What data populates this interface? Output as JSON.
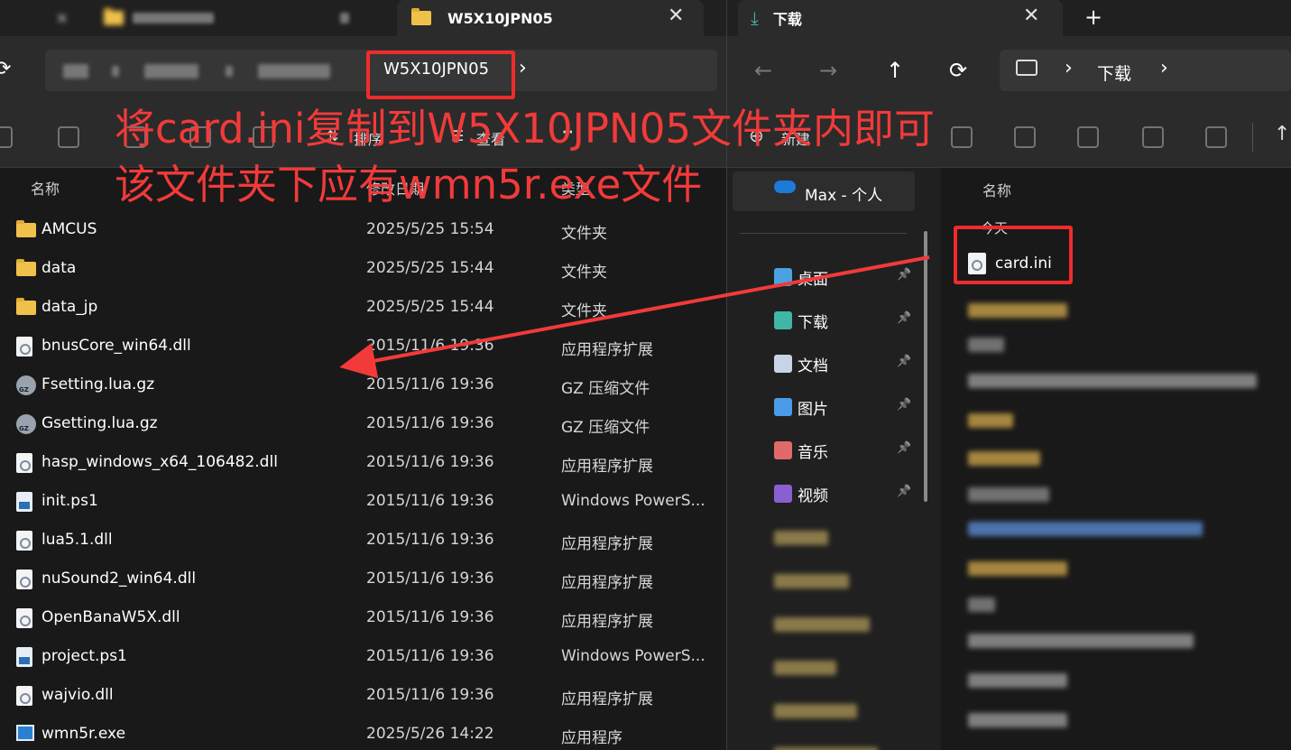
{
  "left_window": {
    "tabs": {
      "inactive_label": "",
      "active_title": "W5X10JPN05",
      "close": "✕"
    },
    "address": {
      "current_folder": "W5X10JPN05",
      "chevron": "›",
      "refresh": "⟳"
    },
    "toolbar": {
      "sort_label": "排序",
      "view_label": "查看",
      "more_label": "⋯"
    },
    "columns": {
      "name": "名称",
      "date": "修改日期",
      "type": "类型"
    },
    "files": [
      {
        "name": "AMCUS",
        "date": "2025/5/25 15:54",
        "type": "文件夹",
        "icon": "folder-icon"
      },
      {
        "name": "data",
        "date": "2025/5/25 15:44",
        "type": "文件夹",
        "icon": "folder-icon"
      },
      {
        "name": "data_jp",
        "date": "2025/5/25 15:44",
        "type": "文件夹",
        "icon": "folder-icon"
      },
      {
        "name": "bnusCore_win64.dll",
        "date": "2015/11/6 19:36",
        "type": "应用程序扩展",
        "icon": "dll-file-icon"
      },
      {
        "name": "Fsetting.lua.gz",
        "date": "2015/11/6 19:36",
        "type": "GZ 压缩文件",
        "icon": "gz-file-icon"
      },
      {
        "name": "Gsetting.lua.gz",
        "date": "2015/11/6 19:36",
        "type": "GZ 压缩文件",
        "icon": "gz-file-icon"
      },
      {
        "name": "hasp_windows_x64_106482.dll",
        "date": "2015/11/6 19:36",
        "type": "应用程序扩展",
        "icon": "dll-file-icon"
      },
      {
        "name": "init.ps1",
        "date": "2015/11/6 19:36",
        "type": "Windows PowerS...",
        "icon": "powershell-file-icon"
      },
      {
        "name": "lua5.1.dll",
        "date": "2015/11/6 19:36",
        "type": "应用程序扩展",
        "icon": "dll-file-icon"
      },
      {
        "name": "nuSound2_win64.dll",
        "date": "2015/11/6 19:36",
        "type": "应用程序扩展",
        "icon": "dll-file-icon"
      },
      {
        "name": "OpenBanaW5X.dll",
        "date": "2015/11/6 19:36",
        "type": "应用程序扩展",
        "icon": "dll-file-icon"
      },
      {
        "name": "project.ps1",
        "date": "2015/11/6 19:36",
        "type": "Windows PowerS...",
        "icon": "powershell-file-icon"
      },
      {
        "name": "wajvio.dll",
        "date": "2015/11/6 19:36",
        "type": "应用程序扩展",
        "icon": "dll-file-icon"
      },
      {
        "name": "wmn5r.exe",
        "date": "2025/5/26 14:22",
        "type": "应用程序",
        "icon": "exe-file-icon"
      }
    ]
  },
  "right_window": {
    "tab_title": "下载",
    "tab_close": "✕",
    "new_tab": "+",
    "nav": {
      "back": "←",
      "forward": "→",
      "up": "↑",
      "refresh": "⟳"
    },
    "address": {
      "chevron": "›",
      "folder": "下载"
    },
    "toolbar": {
      "new_label": "新建"
    },
    "sidebar": {
      "onedrive": "Max - 个人",
      "quick_access": [
        {
          "label": "桌面",
          "icon": "desktop-icon",
          "pin": "📌"
        },
        {
          "label": "下载",
          "icon": "download-icon",
          "pin": "📌"
        },
        {
          "label": "文档",
          "icon": "documents-icon",
          "pin": "📌"
        },
        {
          "label": "图片",
          "icon": "pictures-icon",
          "pin": "📌"
        },
        {
          "label": "音乐",
          "icon": "music-icon",
          "pin": "📌"
        },
        {
          "label": "视频",
          "icon": "videos-icon",
          "pin": "📌"
        }
      ]
    },
    "list": {
      "column_name": "名称",
      "group_today": "今天",
      "highlight_file": "card.ini"
    }
  },
  "annotation": {
    "line1": "将card.ini复制到W5X10JPN05文件夹内即可",
    "line2": "该文件夹下应有wmn5r.exe文件",
    "color": "#f23a3a"
  }
}
